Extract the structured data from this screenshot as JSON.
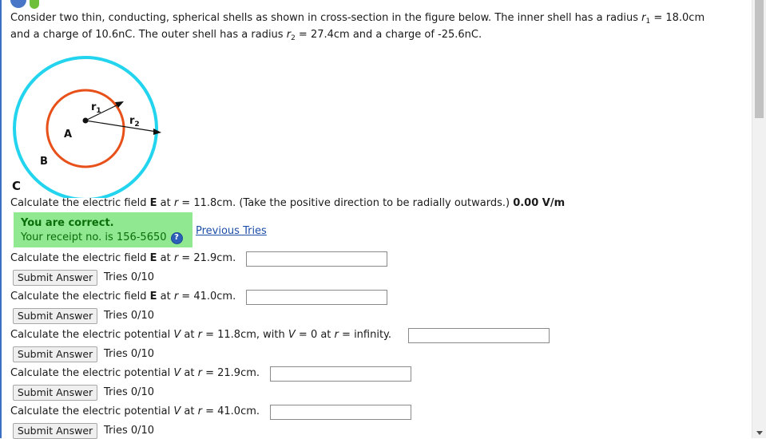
{
  "intro": {
    "line1_pre": "Consider two thin, conducting, spherical shells as shown in cross-section in the figure below. The inner shell has a radius ",
    "r1_sym": "r",
    "r1_sub": "1",
    "line1_post": " = 18.0cm",
    "line2_pre": "and a charge of 10.6nC. The outer shell has a radius ",
    "r2_sym": "r",
    "r2_sub": "2",
    "line2_post": " = 27.4cm and a charge of -25.6nC."
  },
  "figure": {
    "label_a": "A",
    "label_b": "B",
    "label_c": "C",
    "label_r1": "r1",
    "label_r2": "r2",
    "inner_color": "#e8501a",
    "outer_color": "#22d4ee"
  },
  "questions": [
    {
      "pre": "Calculate the electric field ",
      "bold": "E",
      "mid": " at ",
      "var": "r",
      "post": " = 11.8cm. (Take the positive direction to be radially outwards.) ",
      "answer": "0.00 V/m",
      "status": {
        "title": "You are correct.",
        "receipt": "Your receipt no. is 156-5650",
        "prev_tries": "Previous Tries"
      }
    },
    {
      "pre": "Calculate the electric field ",
      "bold": "E",
      "mid": " at ",
      "var": "r",
      "post": " = 21.9cm.",
      "input_value": "",
      "submit_label": "Submit Answer",
      "tries": "Tries 0/10"
    },
    {
      "pre": "Calculate the electric field ",
      "bold": "E",
      "mid": " at ",
      "var": "r",
      "post": " = 41.0cm.",
      "input_value": "",
      "submit_label": "Submit Answer",
      "tries": "Tries 0/10"
    },
    {
      "pre": "Calculate the electric potential ",
      "var_v": "V",
      "mid": " at ",
      "var": "r",
      "post": " = 11.8cm, with ",
      "var_v2": "V",
      "mid2": " = 0 at ",
      "var2": "r",
      "post2": " = infinity.",
      "input_value": "",
      "submit_label": "Submit Answer",
      "tries": "Tries 0/10"
    },
    {
      "pre": "Calculate the electric potential ",
      "var_v": "V",
      "mid": " at ",
      "var": "r",
      "post": " = 21.9cm.",
      "input_value": "",
      "submit_label": "Submit Answer",
      "tries": "Tries 0/10"
    },
    {
      "pre": "Calculate the electric potential ",
      "var_v": "V",
      "mid": " at ",
      "var": "r",
      "post": " = 41.0cm.",
      "input_value": "",
      "submit_label": "Submit Answer",
      "tries": "Tries 0/10"
    }
  ]
}
